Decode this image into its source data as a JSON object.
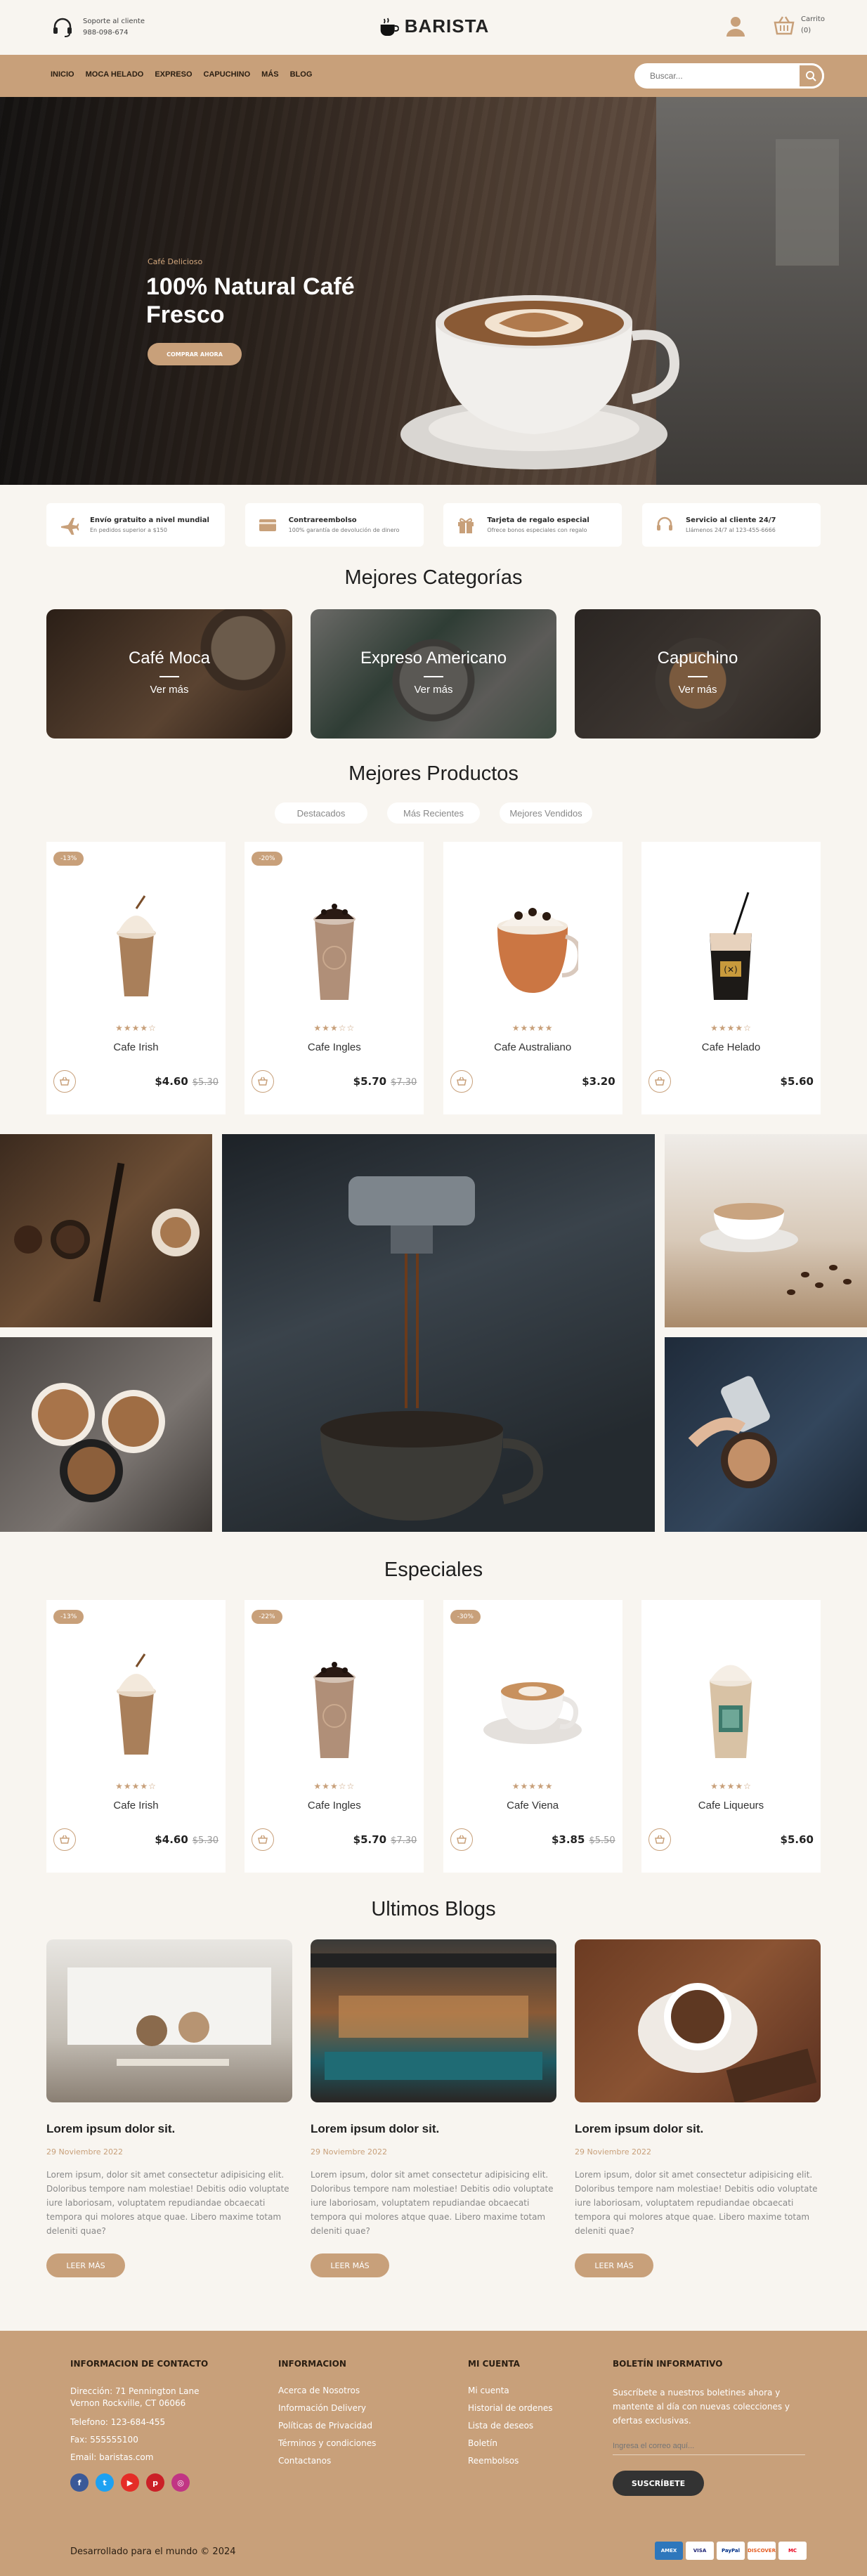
{
  "header": {
    "support_label": "Soporte al cliente",
    "support_phone": "988-098-674",
    "brand": "BARISTA",
    "cart_label": "Carrito",
    "cart_count": "(0)"
  },
  "nav": {
    "items": [
      "INICIO",
      "MOCA HELADO",
      "EXPRESO",
      "CAPUCHINO",
      "MÁS",
      "BLOG"
    ],
    "search_placeholder": "Buscar..."
  },
  "hero": {
    "kicker": "Café Delicioso",
    "title": "100% Natural Café Fresco",
    "cta": "COMPRAR AHORA"
  },
  "features": [
    {
      "icon": "plane-icon",
      "title": "Envío gratuito a nivel mundial",
      "sub": "En pedidos superior a $150"
    },
    {
      "icon": "money-icon",
      "title": "Contrareembolso",
      "sub": "100% garantía de devolución de dinero"
    },
    {
      "icon": "gift-icon",
      "title": "Tarjeta de regalo especial",
      "sub": "Ofrece bonos especiales con regalo"
    },
    {
      "icon": "headset-icon",
      "title": "Servicio al cliente 24/7",
      "sub": "Llámenos 24/7 al 123-455-6666"
    }
  ],
  "categories": {
    "title": "Mejores Categorías",
    "items": [
      {
        "name": "Café Moca",
        "more": "Ver más"
      },
      {
        "name": "Expreso Americano",
        "more": "Ver más"
      },
      {
        "name": "Capuchino",
        "more": "Ver más"
      }
    ]
  },
  "products": {
    "title": "Mejores Productos",
    "tabs": [
      "Destacados",
      "Más Recientes",
      "Mejores Vendidos"
    ],
    "items": [
      {
        "badge": "-13%",
        "name": "Cafe Irish",
        "price": "$4.60",
        "old": "$5.30",
        "stars": "★★★★☆",
        "img": "frappe"
      },
      {
        "badge": "-20%",
        "name": "Cafe Ingles",
        "price": "$5.70",
        "old": "$7.30",
        "stars": "★★★☆☆",
        "img": "boba"
      },
      {
        "badge": "",
        "name": "Cafe Australiano",
        "price": "$3.20",
        "old": "",
        "stars": "★★★★★",
        "img": "mug"
      },
      {
        "badge": "",
        "name": "Cafe Helado",
        "price": "$5.60",
        "old": "",
        "stars": "★★★★☆",
        "img": "iced"
      }
    ]
  },
  "specials": {
    "title": "Especiales",
    "items": [
      {
        "badge": "-13%",
        "name": "Cafe Irish",
        "price": "$4.60",
        "old": "$5.30",
        "stars": "★★★★☆",
        "img": "frappe"
      },
      {
        "badge": "-22%",
        "name": "Cafe Ingles",
        "price": "$5.70",
        "old": "$7.30",
        "stars": "★★★☆☆",
        "img": "boba"
      },
      {
        "badge": "-30%",
        "name": "Cafe Viena",
        "price": "$3.85",
        "old": "$5.50",
        "stars": "★★★★★",
        "img": "cup"
      },
      {
        "badge": "",
        "name": "Cafe Liqueurs",
        "price": "$5.60",
        "old": "",
        "stars": "★★★★☆",
        "img": "latte"
      }
    ]
  },
  "blogs": {
    "title": "Ultimos Blogs",
    "items": [
      {
        "title": "Lorem ipsum dolor sit.",
        "date": "29 Noviembre 2022",
        "text": "Lorem ipsum, dolor sit amet consectetur adipisicing elit. Doloribus tempore nam molestiae! Debitis odio voluptate iure laboriosam, voluptatem repudiandae obcaecati tempora qui molores atque quae. Libero maxime totam deleniti quae?",
        "btn": "LEER MÁS"
      },
      {
        "title": "Lorem ipsum dolor sit.",
        "date": "29 Noviembre 2022",
        "text": "Lorem ipsum, dolor sit amet consectetur adipisicing elit. Doloribus tempore nam molestiae! Debitis odio voluptate iure laboriosam, voluptatem repudiandae obcaecati tempora qui molores atque quae. Libero maxime totam deleniti quae?",
        "btn": "LEER MÁS"
      },
      {
        "title": "Lorem ipsum dolor sit.",
        "date": "29 Noviembre 2022",
        "text": "Lorem ipsum, dolor sit amet consectetur adipisicing elit. Doloribus tempore nam molestiae! Debitis odio voluptate iure laboriosam, voluptatem repudiandae obcaecati tempora qui molores atque quae. Libero maxime totam deleniti quae?",
        "btn": "LEER MÁS"
      }
    ]
  },
  "footer": {
    "contact_title": "INFORMACION DE CONTACTO",
    "contact": [
      "Dirección: 71 Pennington Lane Vernon Rockville, CT 06066",
      "Telefono: 123-684-455",
      "Fax: 555555100",
      "Email: baristas.com"
    ],
    "info_title": "INFORMACION",
    "info": [
      "Acerca de Nosotros",
      "Información Delivery",
      "Políticas de Privacidad",
      "Términos y condiciones",
      "Contactanos"
    ],
    "account_title": "MI CUENTA",
    "account": [
      "Mi cuenta",
      "Historial de ordenes",
      "Lista de deseos",
      "Boletín",
      "Reembolsos"
    ],
    "newsletter_title": "BOLETÍN INFORMATIVO",
    "newsletter_text": "Suscríbete a nuestros boletines ahora y mantente al día con nuevas colecciones y ofertas exclusivas.",
    "newsletter_placeholder": "Ingresa el correo aquí...",
    "newsletter_btn": "SUSCRÍBETE",
    "copyright": "Desarrollado para el mundo © 2024",
    "payments": [
      "AMEX",
      "VISA",
      "PayPal",
      "DISCOVER",
      "MC"
    ]
  }
}
